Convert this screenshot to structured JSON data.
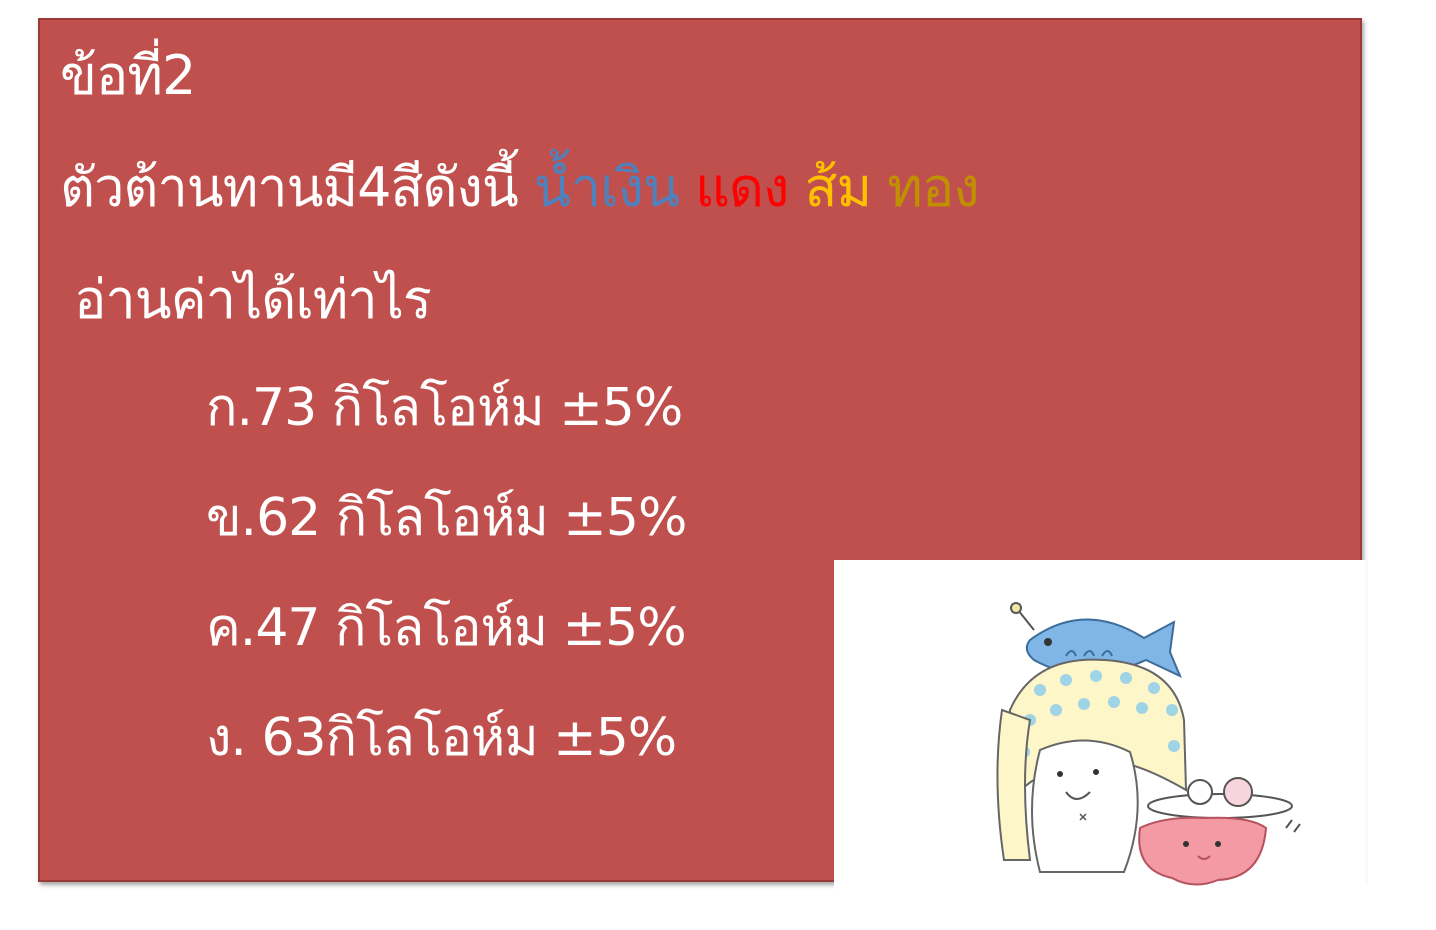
{
  "slide": {
    "title": "ข้อที่2",
    "question_prefix": "ตัวต้านทานมี4สีดังนี้",
    "colors": [
      {
        "label": "น้ำเงิน",
        "color": "#4f81bd"
      },
      {
        "label": "แดง",
        "color": "#ff0000"
      },
      {
        "label": "ส้ม",
        "color": "#ffc000"
      },
      {
        "label": "ทอง",
        "color": "#c09000"
      }
    ],
    "question_line2": "อ่านค่าได้เท่าไร",
    "options": [
      "ก.73 กิโลโอห์ม ±5%",
      "ข.62 กิโลโอห์ม ±5%",
      "ค.47 กิโลโอห์ม ±5%",
      "ง. 63กิโลโอห์ม ±5%"
    ],
    "background_color": "#c0504d"
  },
  "illustration": {
    "icon": "cute-character-with-fish-hat-icon"
  }
}
